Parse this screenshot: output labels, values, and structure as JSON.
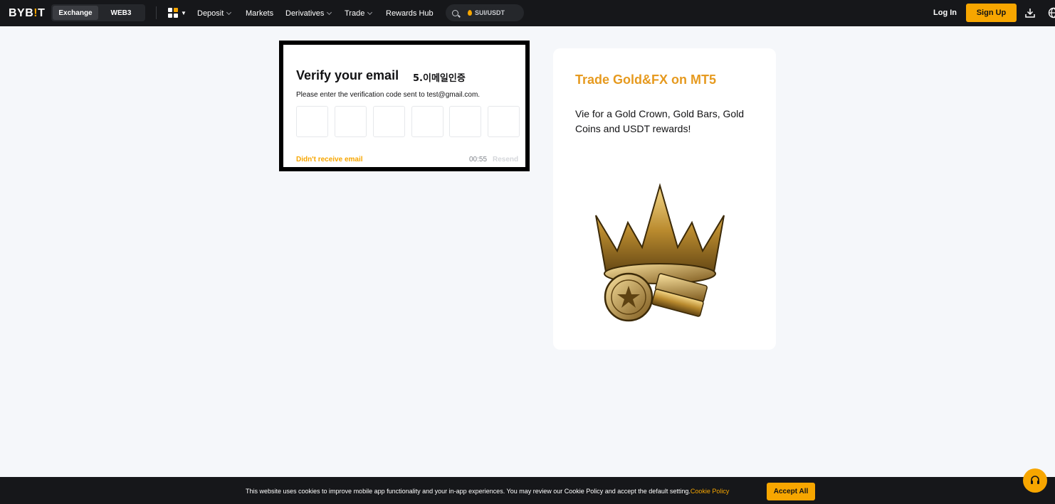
{
  "header": {
    "logo_main": "BYB",
    "logo_bang": "!",
    "logo_end": "T",
    "modes": [
      "Exchange",
      "WEB3"
    ],
    "nav": [
      {
        "label": "Deposit",
        "dropdown": true
      },
      {
        "label": "Markets",
        "dropdown": false
      },
      {
        "label": "Derivatives",
        "dropdown": true
      },
      {
        "label": "Trade",
        "dropdown": true
      },
      {
        "label": "Rewards Hub",
        "dropdown": false
      }
    ],
    "search_text": "SUI/USDT",
    "login_label": "Log In",
    "signup_label": "Sign Up"
  },
  "verify": {
    "title": "Verify your email",
    "annotation": "5.이메일인증",
    "subtitle": "Please enter the verification code sent to test@gmail.com.",
    "code_digits": [
      "",
      "",
      "",
      "",
      "",
      ""
    ],
    "didnt_receive": "Didn't receive email",
    "timer": "00:55",
    "resend": "Resend"
  },
  "promo": {
    "title": "Trade Gold&FX on MT5",
    "body": "Vie for a Gold Crown, Gold Bars, Gold Coins and USDT rewards!"
  },
  "cookie": {
    "message": "This website uses cookies to improve mobile app functionality and your in-app experiences. You may review our Cookie Policy and accept the default setting.",
    "link": "Cookie Policy",
    "accept_label": "Accept All"
  },
  "colors": {
    "brand": "#f7a600",
    "header_bg": "#16171a",
    "page_bg": "#f5f7fa",
    "promo_title": "#e69a1f"
  }
}
